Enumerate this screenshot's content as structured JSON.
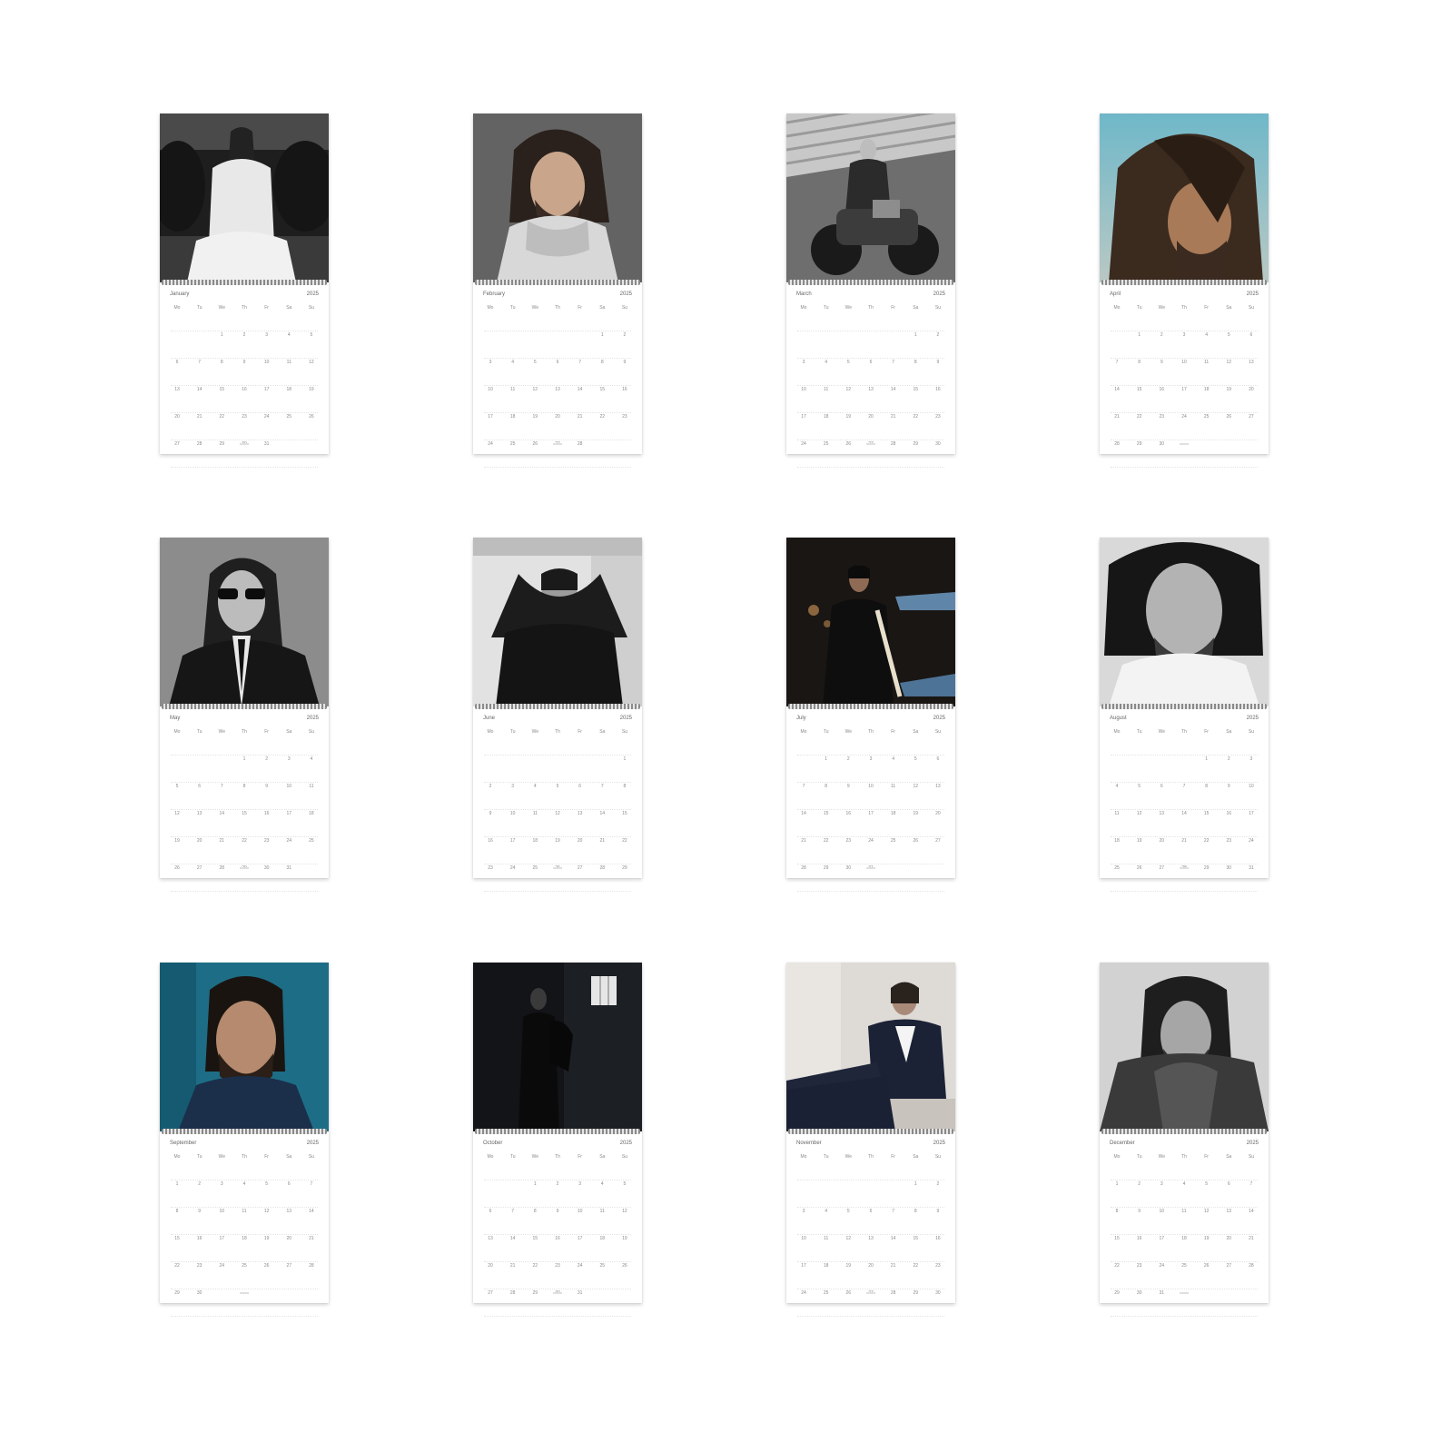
{
  "year": "2025",
  "weekday_headers": [
    "Mo",
    "Tu",
    "We",
    "Th",
    "Fr",
    "Sa",
    "Su"
  ],
  "months": [
    {
      "name": "January",
      "photo": "portrait-white-suit-on-leather-sofa"
    },
    {
      "name": "February",
      "photo": "portrait-turtleneck-sweater"
    },
    {
      "name": "March",
      "photo": "portrait-on-motorcycle"
    },
    {
      "name": "April",
      "photo": "portrait-windblown-hair-blue-sky"
    },
    {
      "name": "May",
      "photo": "portrait-sunglasses-dark-suit"
    },
    {
      "name": "June",
      "photo": "portrait-hands-behind-head"
    },
    {
      "name": "July",
      "photo": "portrait-suit-fitting-measuring-tape"
    },
    {
      "name": "August",
      "photo": "portrait-close-up-white-tee"
    },
    {
      "name": "September",
      "photo": "portrait-teal-background-jacket"
    },
    {
      "name": "October",
      "photo": "portrait-dark-room-window"
    },
    {
      "name": "November",
      "photo": "portrait-reclining-blazer"
    },
    {
      "name": "December",
      "photo": "portrait-coat-close-up"
    }
  ],
  "colors": {
    "background": "#ffffff",
    "page": "#ffffff",
    "day_text": "#8a8a8a",
    "binding_dark": "#8a8a8a"
  }
}
